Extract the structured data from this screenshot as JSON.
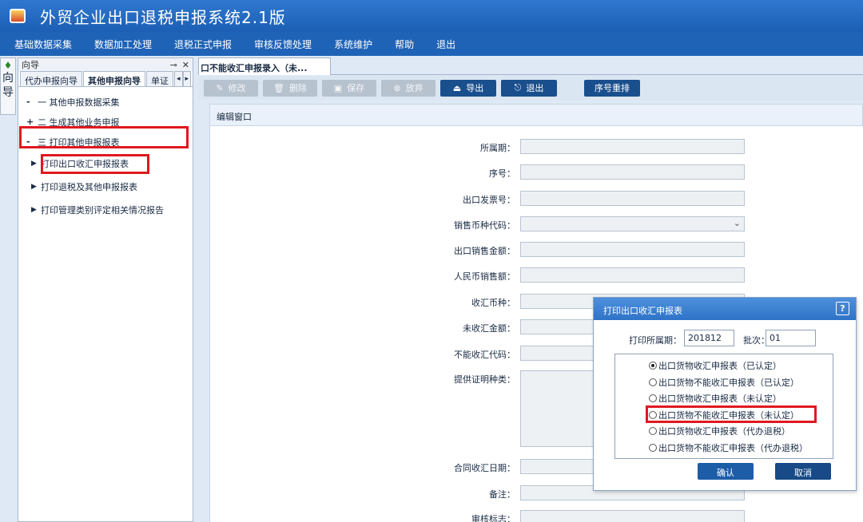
{
  "app": {
    "title": "外贸企业出口退税申报系统2.1版"
  },
  "menu": [
    "基础数据采集",
    "数据加工处理",
    "退税正式申报",
    "审核反馈处理",
    "系统维护",
    "帮助",
    "退出"
  ],
  "left_strip": {
    "label": "向导"
  },
  "navigator": {
    "header_title": "向导",
    "header_tools": {
      "pin": "⊸",
      "close": "✕"
    },
    "tabs": [
      "代办申报向导",
      "其他申报向导",
      "单证"
    ],
    "tab_arrows": [
      "◂",
      "▸"
    ],
    "tree": [
      {
        "expander": "-",
        "label": "一  其他申报数据采集"
      },
      {
        "expander": "+",
        "label": "二  生成其他业务申报"
      },
      {
        "expander": "-",
        "label": "三  打印其他申报报表"
      }
    ],
    "children": [
      {
        "label": "打印出口收汇申报报表"
      },
      {
        "label": "打印退税及其他申报报表"
      },
      {
        "label": "打印管理类别评定相关情况报告"
      }
    ]
  },
  "doc_tab": {
    "label": "口不能收汇申报录入（未..."
  },
  "toolbar": {
    "buttons": [
      {
        "label": "修改",
        "icon": "pencil-icon",
        "glyph": "✎",
        "state": "disabled"
      },
      {
        "label": "删除",
        "icon": "trash-icon",
        "glyph": "🗑",
        "state": "disabled"
      },
      {
        "label": "保存",
        "icon": "save-icon",
        "glyph": "▣",
        "state": "disabled"
      },
      {
        "label": "放弃",
        "icon": "cancel-icon",
        "glyph": "⊗",
        "state": "disabled"
      },
      {
        "label": "导出",
        "icon": "export-icon",
        "glyph": "⏏",
        "state": "enabled"
      },
      {
        "label": "退出",
        "icon": "exit-icon",
        "glyph": "⎋",
        "state": "enabled"
      },
      {
        "label": "序号重排",
        "icon": "",
        "glyph": "",
        "state": "enabled"
      }
    ]
  },
  "edit": {
    "header": "编辑窗口",
    "fields": [
      {
        "label": "所属期：",
        "type": "text"
      },
      {
        "label": "序号：",
        "type": "text"
      },
      {
        "label": "出口发票号：",
        "type": "text"
      },
      {
        "label": "销售币种代码：",
        "type": "select"
      },
      {
        "label": "出口销售金额：",
        "type": "text"
      },
      {
        "label": "人民币销售额：",
        "type": "text"
      },
      {
        "label": "收汇币种：",
        "type": "text"
      },
      {
        "label": "未收汇金额：",
        "type": "text"
      },
      {
        "label": "不能收汇代码：",
        "type": "text"
      },
      {
        "label": "提供证明种类：",
        "type": "textarea"
      },
      {
        "label": "合同收汇日期：",
        "type": "text"
      },
      {
        "label": "备注：",
        "type": "text"
      },
      {
        "label": "审核标志：",
        "type": "text"
      }
    ]
  },
  "dialog": {
    "title": "打印出口收汇申报表",
    "help": "?",
    "period_label": "打印所属期：",
    "period_value": "201812",
    "batch_label": "批次：",
    "batch_value": "01",
    "options": [
      {
        "label": "出口货物收汇申报表（已认定）",
        "checked": true
      },
      {
        "label": "出口货物不能收汇申报表（已认定）",
        "checked": false
      },
      {
        "label": "出口货物收汇申报表（未认定）",
        "checked": false
      },
      {
        "label": "出口货物不能收汇申报表（未认定）",
        "checked": false
      },
      {
        "label": "出口货物收汇申报表（代办退税）",
        "checked": false
      },
      {
        "label": "出口货物不能收汇申报表（代办退税）",
        "checked": false
      }
    ],
    "confirm_label": "确认",
    "cancel_label": "取消"
  },
  "colors": {
    "highlight": "#e0191f",
    "title_bar": "#2f78cf",
    "button_dark": "#1a4f8d"
  }
}
